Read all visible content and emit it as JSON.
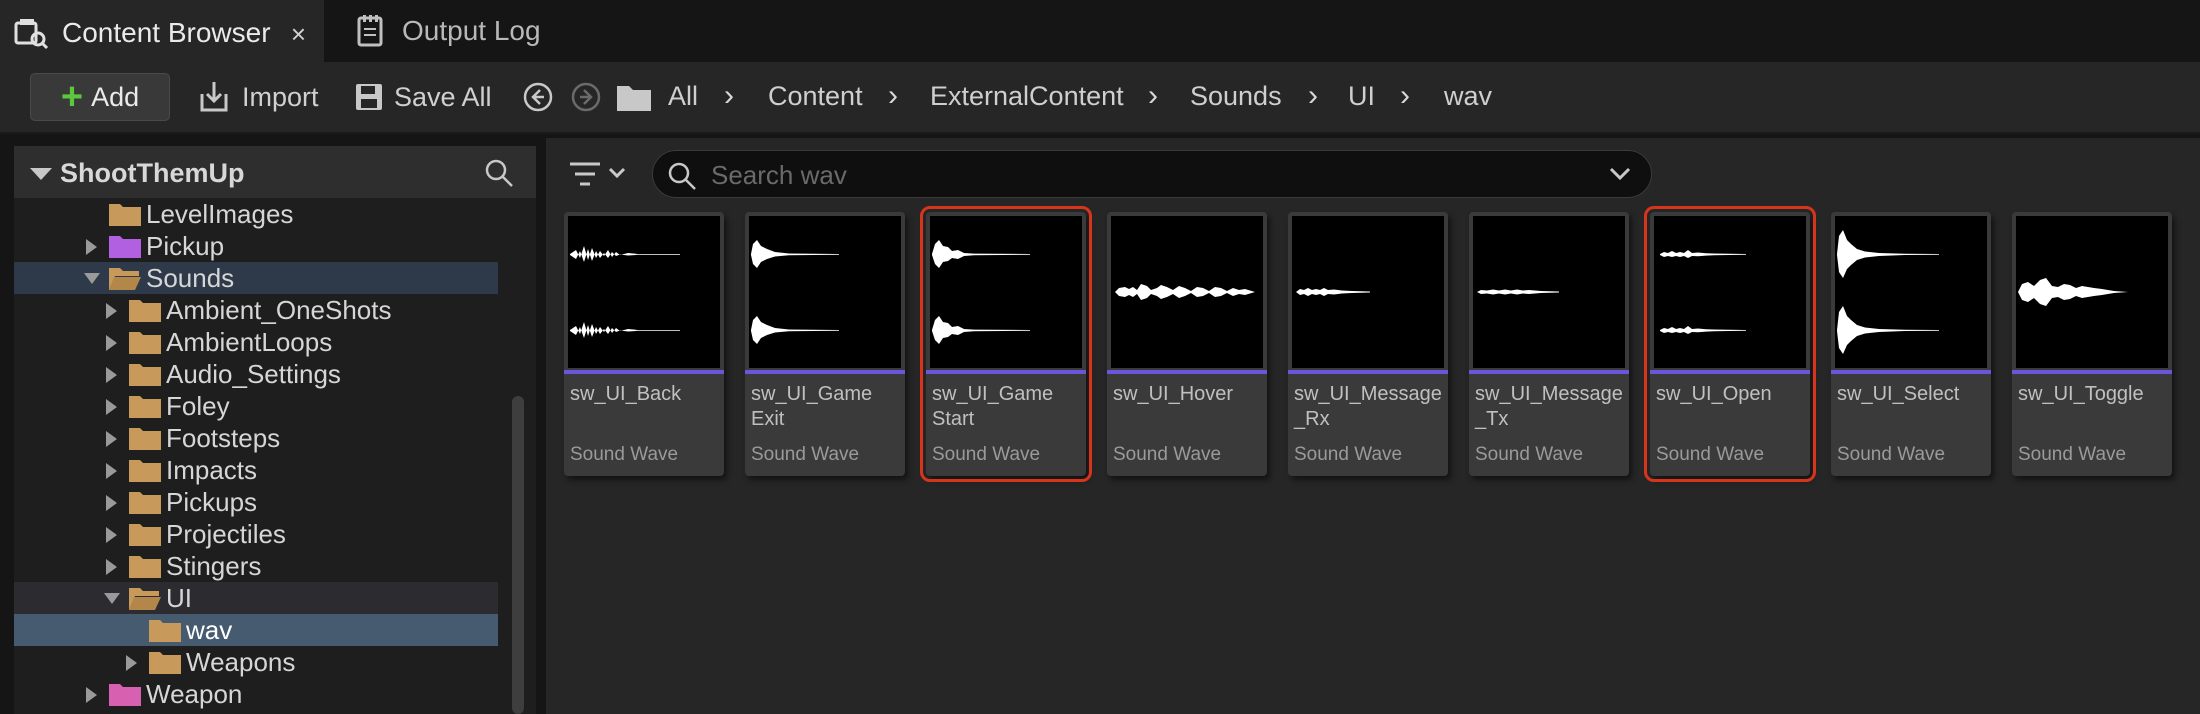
{
  "tabs": [
    {
      "label": "Content Browser",
      "icon": "content-browser-icon",
      "close": "×"
    },
    {
      "label": "Output Log",
      "icon": "output-log-icon"
    }
  ],
  "toolbar": {
    "add_label": "Add",
    "import_label": "Import",
    "save_all_label": "Save All"
  },
  "breadcrumb": [
    "All",
    "Content",
    "ExternalContent",
    "Sounds",
    "UI",
    "wav"
  ],
  "sources": {
    "root": "ShootThemUp",
    "tree": [
      {
        "label": "LevelImages"
      },
      {
        "label": "Pickup"
      },
      {
        "label": "Sounds"
      },
      {
        "label": "Ambient_OneShots"
      },
      {
        "label": "AmbientLoops"
      },
      {
        "label": "Audio_Settings"
      },
      {
        "label": "Foley"
      },
      {
        "label": "Footsteps"
      },
      {
        "label": "Impacts"
      },
      {
        "label": "Pickups"
      },
      {
        "label": "Projectiles"
      },
      {
        "label": "Stingers"
      },
      {
        "label": "UI"
      },
      {
        "label": "wav"
      },
      {
        "label": "Weapons"
      },
      {
        "label": "Weapon"
      }
    ]
  },
  "search": {
    "placeholder": "Search wav",
    "value": ""
  },
  "assets": [
    {
      "name": "sw_UI_Back",
      "type": "Sound Wave"
    },
    {
      "name": "sw_UI_Game Exit",
      "type": "Sound Wave"
    },
    {
      "name": "sw_UI_Game Start",
      "type": "Sound Wave"
    },
    {
      "name": "sw_UI_Hover",
      "type": "Sound Wave"
    },
    {
      "name": "sw_UI_Message _Rx",
      "type": "Sound Wave"
    },
    {
      "name": "sw_UI_Message _Tx",
      "type": "Sound Wave"
    },
    {
      "name": "sw_UI_Open",
      "type": "Sound Wave"
    },
    {
      "name": "sw_UI_Select",
      "type": "Sound Wave"
    },
    {
      "name": "sw_UI_Toggle",
      "type": "Sound Wave"
    }
  ],
  "colors": {
    "sound_wave_bar": "#6a56d8",
    "highlight_outline": "#d7341c",
    "folder": "#c79a5c",
    "folder_pink": "#d860b0",
    "folder_purple": "#b060e0",
    "add_plus": "#5cc63c"
  }
}
